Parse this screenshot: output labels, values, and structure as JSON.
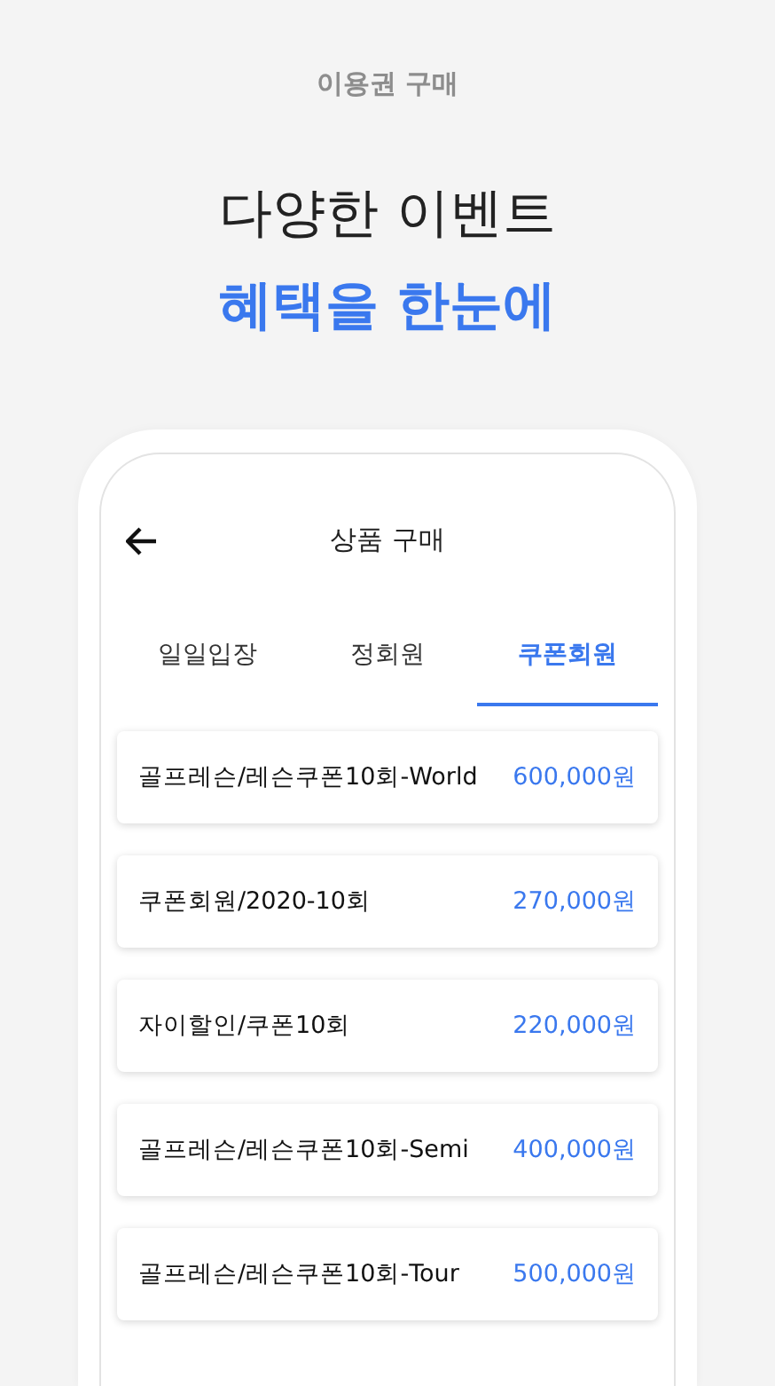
{
  "header": {
    "caption": "이용권 구매",
    "headline": "다양한 이벤트",
    "highlight": "혜택을 한눈에"
  },
  "screen": {
    "title": "상품 구매",
    "tabs": [
      {
        "label": "일일입장",
        "selected": false
      },
      {
        "label": "정회원",
        "selected": false
      },
      {
        "label": "쿠폰회원",
        "selected": true
      }
    ],
    "products": [
      {
        "name": "골프레슨/레슨쿠폰10회-World",
        "price": "600,000원"
      },
      {
        "name": "쿠폰회원/2020-10회",
        "price": "270,000원"
      },
      {
        "name": "자이할인/쿠폰10회",
        "price": "220,000원"
      },
      {
        "name": "골프레슨/레슨쿠폰10회-Semi",
        "price": "400,000원"
      },
      {
        "name": "골프레슨/레슨쿠폰10회-Tour",
        "price": "500,000원"
      }
    ]
  }
}
